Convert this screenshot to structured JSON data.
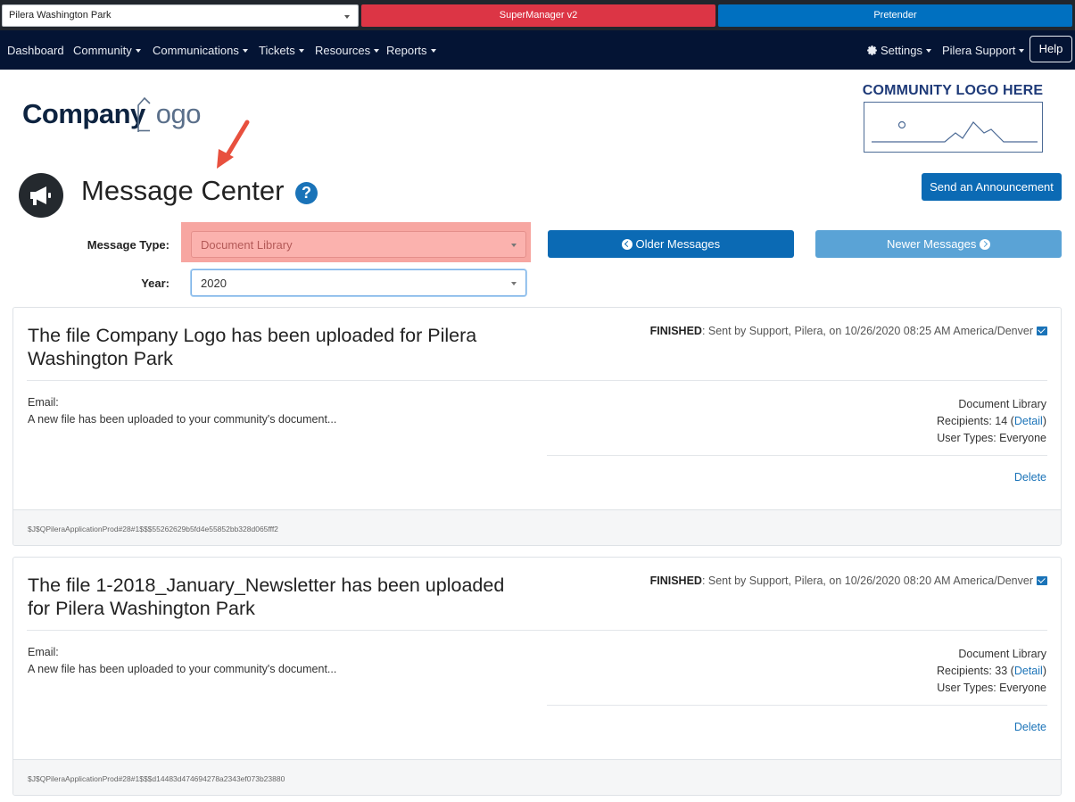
{
  "topbar": {
    "community_select": "Pilera Washington Park",
    "supermanager_label": "SuperManager v2",
    "pretender_label": "Pretender"
  },
  "nav": {
    "items": [
      "Dashboard",
      "Community",
      "Communications",
      "Tickets",
      "Resources",
      "Reports"
    ],
    "settings_label": "Settings",
    "support_label": "Pilera Support",
    "help_label": "Help"
  },
  "logos": {
    "company_bold": "Company",
    "company_light": "ogo",
    "community_title": "COMMUNITY LOGO HERE"
  },
  "page": {
    "title": "Message Center",
    "help_symbol": "?",
    "send_button": "Send an Announcement"
  },
  "filters": {
    "message_type_label": "Message Type:",
    "message_type_value": "Document Library",
    "year_label": "Year:",
    "year_value": "2020",
    "older_label": "Older Messages",
    "newer_label": "Newer Messages"
  },
  "messages": [
    {
      "title": "The file Company Logo has been uploaded for Pilera Washington Park",
      "status": "FINISHED",
      "sent_text": ": Sent by Support, Pilera, on 10/26/2020 08:25 AM America/Denver",
      "email_label": "Email:",
      "email_body": "A new file has been uploaded to your community's document...",
      "category": "Document Library",
      "recipients_prefix": "Recipients: 14 (",
      "detail_link": "Detail",
      "recipients_suffix": ")",
      "user_types": "User Types: Everyone",
      "delete_label": "Delete",
      "footer_id": "$J$QPileraApplicationProd#28#1$$$55262629b5fd4e55852bb328d065fff2"
    },
    {
      "title": "The file 1-2018_January_Newsletter has been uploaded for Pilera Washington Park",
      "status": "FINISHED",
      "sent_text": ": Sent by Support, Pilera, on 10/26/2020 08:20 AM America/Denver",
      "email_label": "Email:",
      "email_body": "A new file has been uploaded to your community's document...",
      "category": "Document Library",
      "recipients_prefix": "Recipients: 33 (",
      "detail_link": "Detail",
      "recipients_suffix": ")",
      "user_types": "User Types: Everyone",
      "delete_label": "Delete",
      "footer_id": "$J$QPileraApplicationProd#28#1$$$d14483d474694278a2343ef073b23880"
    }
  ],
  "colors": {
    "nav_bg": "#041434",
    "primary": "#0b6ab4",
    "supermanager": "#dc3545",
    "pretender": "#0070c0",
    "highlight": "#f7a6a1",
    "annotation_arrow": "#e8503e"
  }
}
